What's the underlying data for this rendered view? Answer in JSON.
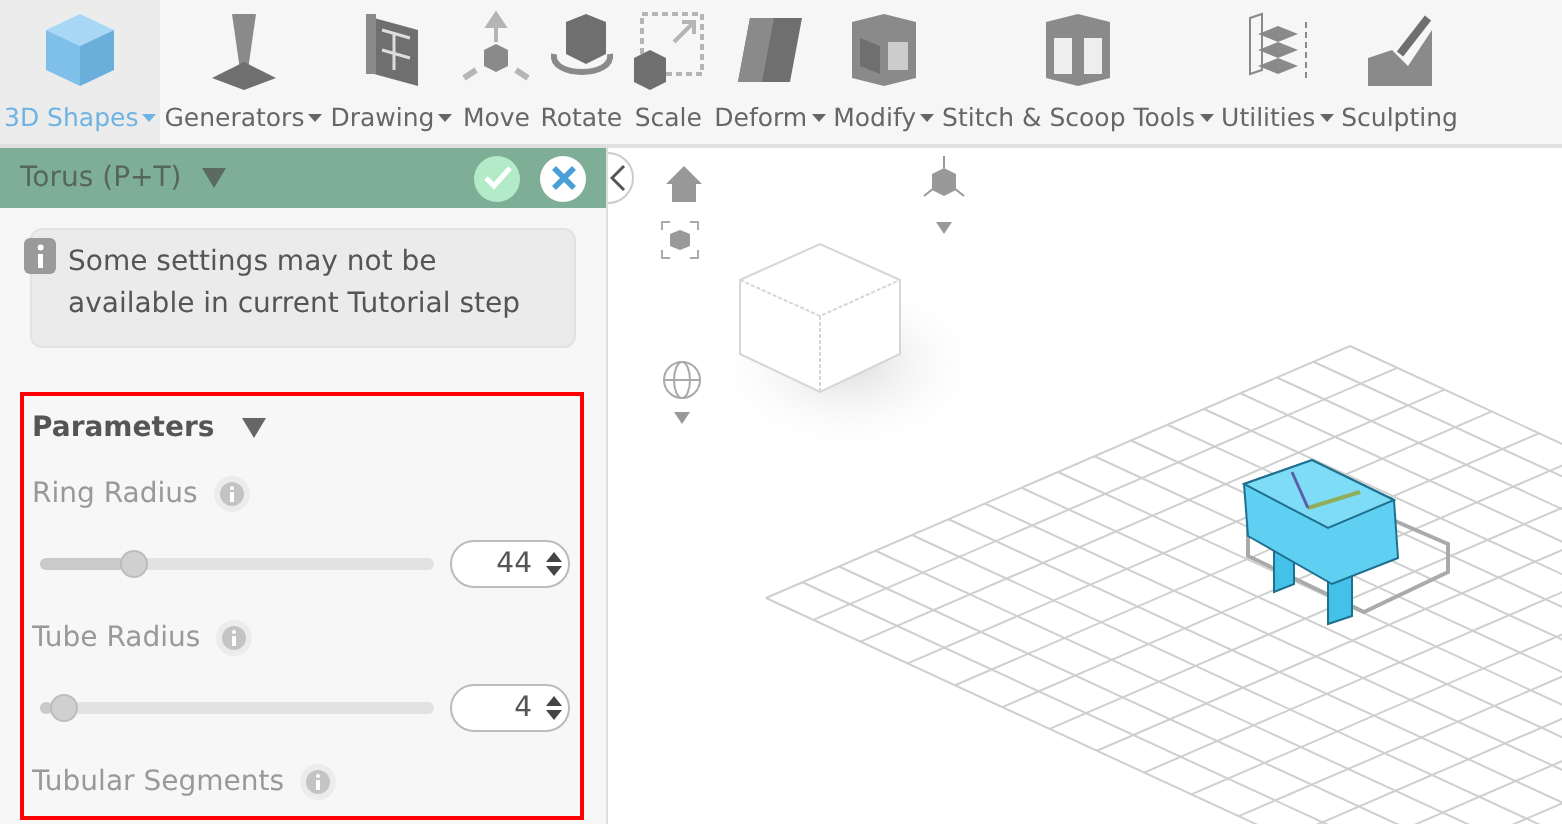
{
  "toolbar": {
    "items": [
      {
        "label": "3D Shapes",
        "dropdown": true,
        "selected": true
      },
      {
        "label": "Generators",
        "dropdown": true,
        "selected": false
      },
      {
        "label": "Drawing",
        "dropdown": true,
        "selected": false
      },
      {
        "label": "Move",
        "dropdown": false,
        "selected": false
      },
      {
        "label": "Rotate",
        "dropdown": false,
        "selected": false
      },
      {
        "label": "Scale",
        "dropdown": false,
        "selected": false
      },
      {
        "label": "Deform",
        "dropdown": true,
        "selected": false
      },
      {
        "label": "Modify",
        "dropdown": true,
        "selected": false
      },
      {
        "label": "Stitch & Scoop Tools",
        "dropdown": true,
        "selected": false
      },
      {
        "label": "Utilities",
        "dropdown": true,
        "selected": false
      },
      {
        "label": "Sculpting",
        "dropdown": false,
        "selected": false
      }
    ]
  },
  "panel": {
    "title": "Torus (P+T)",
    "notice": "Some settings may not be available in current Tutorial step",
    "section": {
      "title": "Parameters",
      "expanded": true,
      "params": [
        {
          "label": "Ring Radius",
          "disabled": true,
          "level": 0.22,
          "value": "44"
        },
        {
          "label": "Tube Radius",
          "disabled": true,
          "level": 0.03,
          "value": "4"
        },
        {
          "label": "Tubular Segments",
          "disabled": true
        }
      ]
    }
  }
}
